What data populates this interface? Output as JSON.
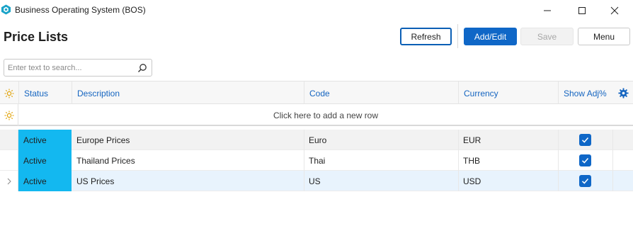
{
  "window": {
    "title": "Business Operating System (BOS)",
    "minimize": "—",
    "maximize": "☐",
    "close": "✕"
  },
  "page": {
    "title": "Price Lists"
  },
  "toolbar": {
    "refresh_label": "Refresh",
    "add_edit_label": "Add/Edit",
    "save_label": "Save",
    "menu_label": "Menu"
  },
  "search": {
    "placeholder": "Enter text to search...",
    "value": ""
  },
  "grid": {
    "columns": [
      "Status",
      "Description",
      "Code",
      "Currency",
      "Show Adj%"
    ],
    "add_row_text": "Click here to add a new row",
    "rows": [
      {
        "status": "Active",
        "description": "Europe Prices",
        "code": "Euro",
        "currency": "EUR",
        "show_adj": true
      },
      {
        "status": "Active",
        "description": "Thailand Prices",
        "code": "Thai",
        "currency": "THB",
        "show_adj": true
      },
      {
        "status": "Active",
        "description": "US Prices",
        "code": "US",
        "currency": "USD",
        "show_adj": true
      }
    ]
  },
  "colors": {
    "accent": "#0f67c7",
    "status_active": "#13b8f0",
    "header_text": "#1565c0",
    "selected_row": "#e8f3fd",
    "alt_row": "#f2f2f2"
  },
  "icons": {
    "app": "app-logo-icon",
    "search": "search-icon",
    "header_left": "sun-icon",
    "add_row": "sun-icon",
    "settings": "gear-icon",
    "row_indicator": "chevron-right-icon",
    "check": "checkmark-icon"
  }
}
